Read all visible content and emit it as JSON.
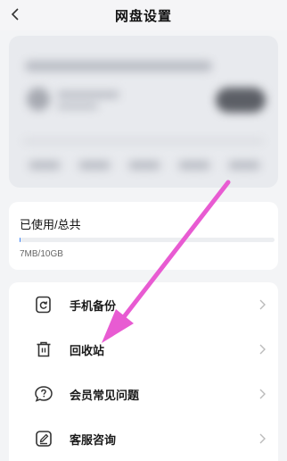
{
  "header": {
    "title": "网盘设置",
    "back_icon": "chevron-left-icon"
  },
  "storage": {
    "title": "已使用/总共",
    "value": "7MB/10GB",
    "used_fraction": 0.0007
  },
  "menu": {
    "items": [
      {
        "label": "手机备份",
        "icon": "phone-backup-icon"
      },
      {
        "label": "回收站",
        "icon": "trash-icon"
      },
      {
        "label": "会员常见问题",
        "icon": "faq-icon"
      },
      {
        "label": "客服咨询",
        "icon": "edit-icon"
      }
    ]
  },
  "annotation": {
    "arrow_color": "#e85bd2"
  }
}
